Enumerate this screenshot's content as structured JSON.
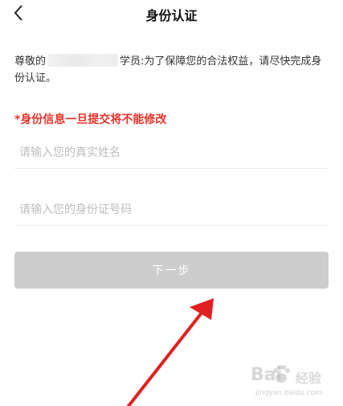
{
  "header": {
    "title": "身份认证",
    "back_icon": "chevron-left-icon"
  },
  "notice": {
    "prefix": "尊敬的",
    "suffix": "学员:为了保障您的合法权益，请尽快完成身份认证。"
  },
  "warning": {
    "text": "*身份信息一旦提交将不能修改",
    "color": "#e6332a"
  },
  "form": {
    "name_placeholder": "请输入您的真实姓名",
    "name_value": "",
    "id_placeholder": "请输入您的身份证号码",
    "id_value": ""
  },
  "next_button": {
    "label": "下一步",
    "bg_color": "#cdcdcd"
  },
  "annotation": {
    "arrow_color": "#e02020"
  },
  "watermark": {
    "logo_text": "Bai",
    "cn_text": "经验",
    "url": "jingyan.baidu.com"
  }
}
